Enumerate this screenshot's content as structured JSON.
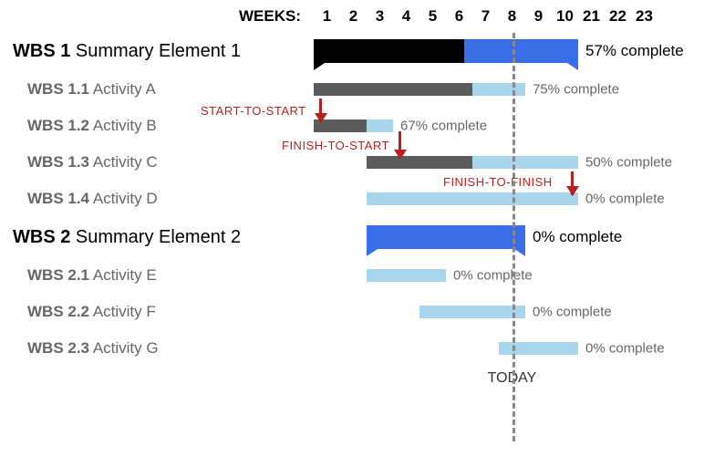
{
  "header": {
    "weeks_label": "WEEKS:"
  },
  "weeks": [
    "1",
    "2",
    "3",
    "4",
    "5",
    "6",
    "7",
    "8",
    "9",
    "10",
    "21",
    "22",
    "23"
  ],
  "today_week": 8,
  "today_label": "TODAY",
  "deps": {
    "start_to_start": "START-TO-START",
    "finish_to_start": "FINISH-TO-START",
    "finish_to_finish": "FINISH-TO-FINISH"
  },
  "rows": [
    {
      "id": "s1",
      "type": "summary",
      "wbs": "WBS 1",
      "name": "Summary Element 1",
      "start": 1,
      "end": 10,
      "progress": 0.57,
      "pct_label": "57% complete"
    },
    {
      "id": "a1",
      "type": "activity",
      "wbs": "WBS 1.1",
      "name": "Activity A",
      "start": 1,
      "end": 8,
      "progress": 0.75,
      "pct_label": "75% complete"
    },
    {
      "id": "a2",
      "type": "activity",
      "wbs": "WBS 1.2",
      "name": "Activity B",
      "start": 1,
      "end": 3,
      "progress": 0.67,
      "pct_label": "67% complete"
    },
    {
      "id": "a3",
      "type": "activity",
      "wbs": "WBS 1.3",
      "name": "Activity C",
      "start": 3,
      "end": 10,
      "progress": 0.5,
      "pct_label": "50% complete"
    },
    {
      "id": "a4",
      "type": "activity",
      "wbs": "WBS 1.4",
      "name": "Activity D",
      "start": 3,
      "end": 10,
      "progress": 0.0,
      "pct_label": "0% complete"
    },
    {
      "id": "s2",
      "type": "summary",
      "wbs": "WBS 2",
      "name": "Summary Element 2",
      "start": 3,
      "end": 8,
      "progress": 0.0,
      "pct_label": "0% complete"
    },
    {
      "id": "a5",
      "type": "activity",
      "wbs": "WBS 2.1",
      "name": "Activity E",
      "start": 3,
      "end": 5,
      "progress": 0.0,
      "pct_label": "0% complete"
    },
    {
      "id": "a6",
      "type": "activity",
      "wbs": "WBS 2.2",
      "name": "Activity F",
      "start": 5,
      "end": 8,
      "progress": 0.0,
      "pct_label": "0% complete"
    },
    {
      "id": "a7",
      "type": "activity",
      "wbs": "WBS 2.3",
      "name": "Activity G",
      "start": 8,
      "end": 10,
      "progress": 0.0,
      "pct_label": "0% complete"
    }
  ],
  "chart_data": {
    "type": "bar",
    "title": "",
    "xlabel": "WEEKS",
    "ylabel": "",
    "categories": [
      "WBS 1 Summary Element 1",
      "WBS 1.1 Activity A",
      "WBS 1.2 Activity B",
      "WBS 1.3 Activity C",
      "WBS 1.4 Activity D",
      "WBS 2 Summary Element 2",
      "WBS 2.1 Activity E",
      "WBS 2.2 Activity F",
      "WBS 2.3 Activity G"
    ],
    "series": [
      {
        "name": "start_week",
        "values": [
          1,
          1,
          1,
          3,
          3,
          3,
          3,
          5,
          8
        ]
      },
      {
        "name": "end_week",
        "values": [
          10,
          8,
          3,
          10,
          10,
          8,
          5,
          8,
          10
        ]
      },
      {
        "name": "progress_pct",
        "values": [
          57,
          75,
          67,
          50,
          0,
          0,
          0,
          0,
          0
        ]
      }
    ],
    "x_ticks": [
      1,
      2,
      3,
      4,
      5,
      6,
      7,
      8,
      9,
      10,
      21,
      22,
      23
    ],
    "today": 8,
    "dependencies": [
      {
        "type": "START-TO-START",
        "from": "WBS 1.1 Activity A",
        "to": "WBS 1.2 Activity B"
      },
      {
        "type": "FINISH-TO-START",
        "from": "WBS 1.2 Activity B",
        "to": "WBS 1.3 Activity C"
      },
      {
        "type": "FINISH-TO-FINISH",
        "from": "WBS 1.3 Activity C",
        "to": "WBS 1.4 Activity D"
      }
    ]
  }
}
